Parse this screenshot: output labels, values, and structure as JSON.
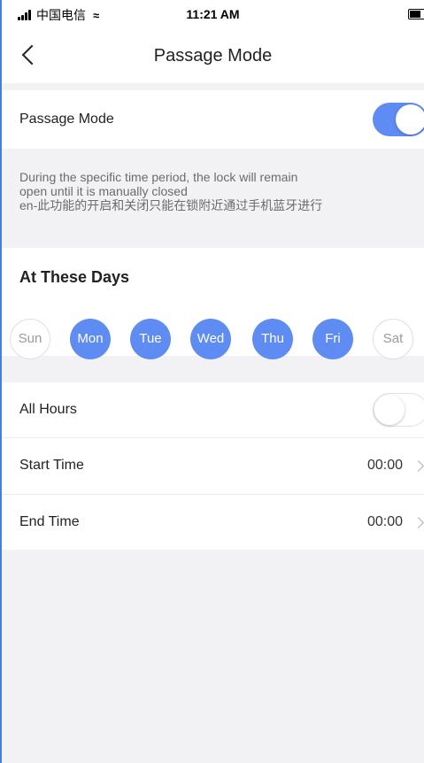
{
  "status_bar": {
    "carrier": "中国电信",
    "time": "11:21 AM"
  },
  "nav": {
    "title": "Passage Mode"
  },
  "passage_mode": {
    "label": "Passage Mode",
    "enabled": true,
    "description_line1": "During the specific time period, the lock will remain",
    "description_line2": "open until it is manually closed",
    "description_line3": "en-此功能的开启和关闭只能在锁附近通过手机蓝牙进行"
  },
  "days": {
    "title": "At These Days",
    "items": [
      {
        "label": "Sun",
        "selected": false
      },
      {
        "label": "Mon",
        "selected": true
      },
      {
        "label": "Tue",
        "selected": true
      },
      {
        "label": "Wed",
        "selected": true
      },
      {
        "label": "Thu",
        "selected": true
      },
      {
        "label": "Fri",
        "selected": true
      },
      {
        "label": "Sat",
        "selected": false
      }
    ]
  },
  "all_hours": {
    "label": "All Hours",
    "enabled": false
  },
  "start_time": {
    "label": "Start Time",
    "value": "00:00"
  },
  "end_time": {
    "label": "End Time",
    "value": "00:00"
  },
  "colors": {
    "accent": "#5f8cf2",
    "background": "#f2f2f4"
  }
}
